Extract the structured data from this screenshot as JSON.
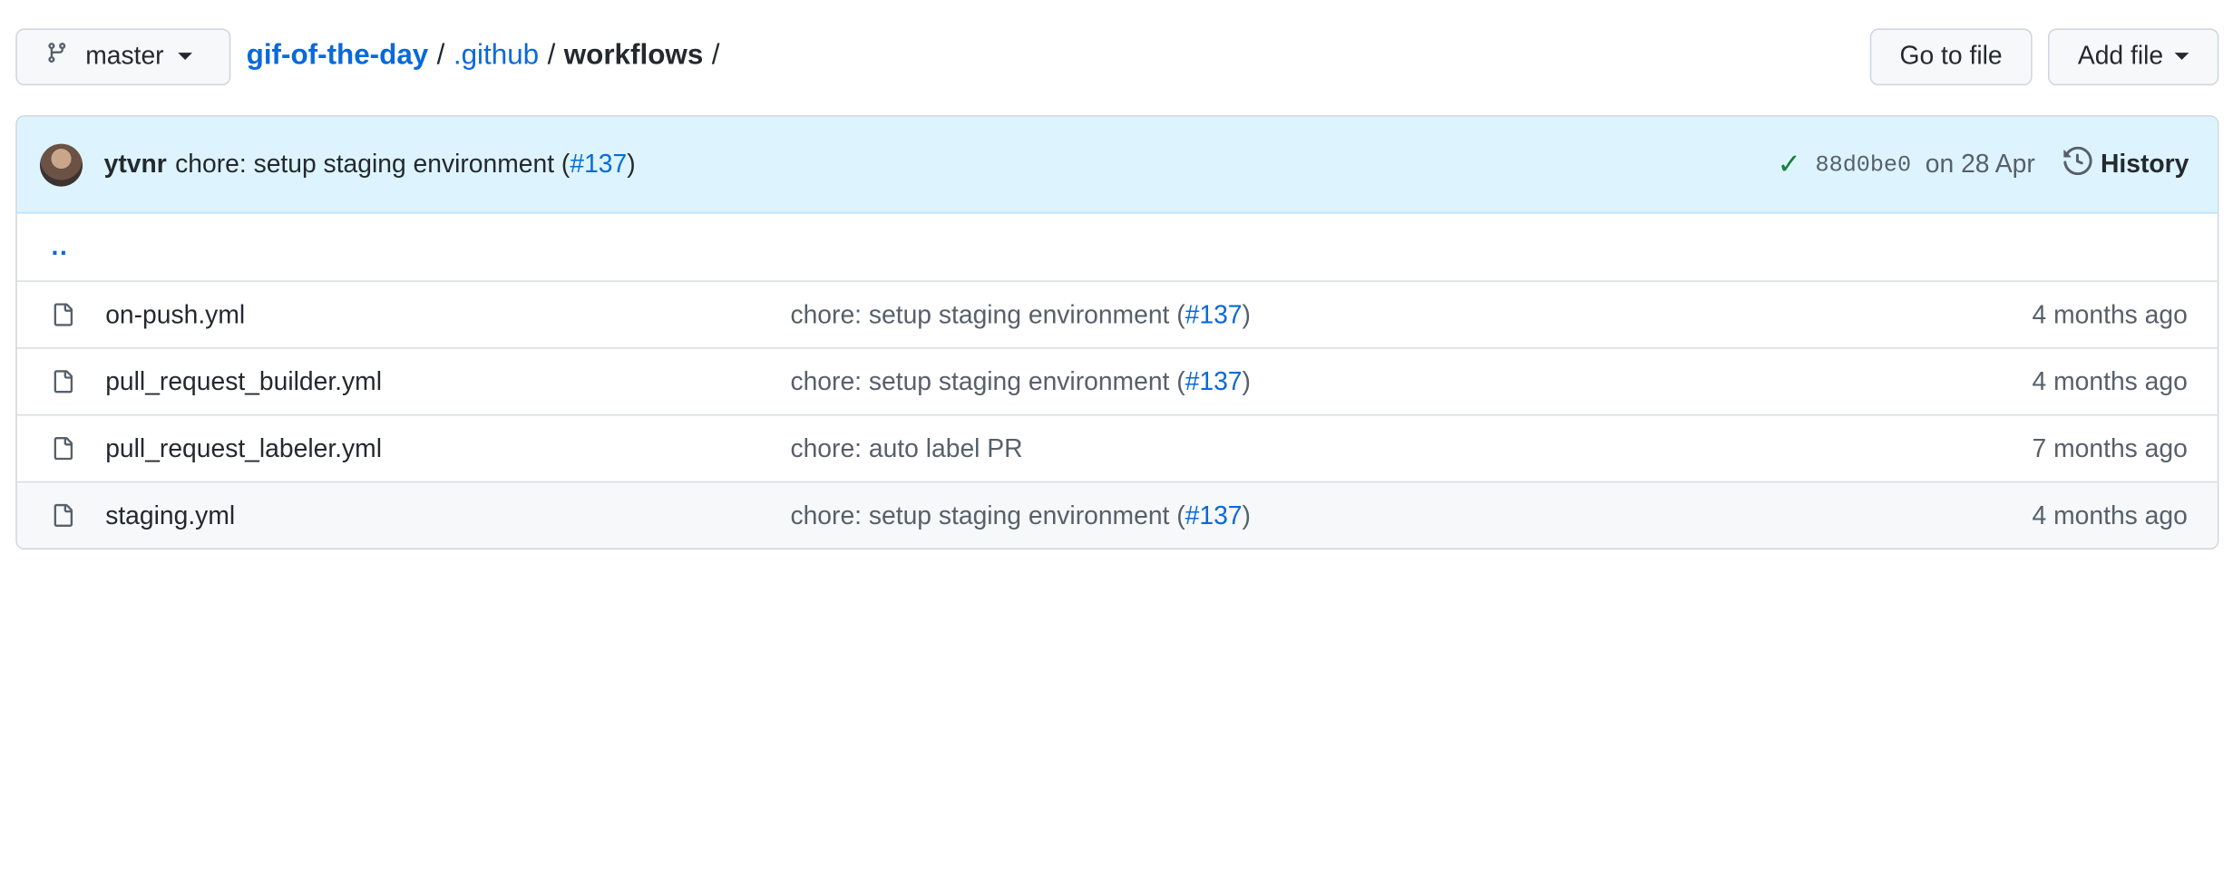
{
  "branch": {
    "label": "master"
  },
  "breadcrumb": {
    "repo": "gif-of-the-day",
    "folder": ".github",
    "current": "workflows",
    "sep": "/"
  },
  "actions": {
    "go_to_file": "Go to file",
    "add_file": "Add file"
  },
  "latest_commit": {
    "author": "ytvnr",
    "message": "chore: setup staging environment (",
    "pr": "#137",
    "message_end": ")",
    "sha": "88d0be0",
    "date": "on 28 Apr",
    "history_label": "History",
    "status_color": "#1a7f37"
  },
  "parent_dir": "..",
  "files": [
    {
      "name": "on-push.yml",
      "message": "chore: setup staging environment (",
      "pr": "#137",
      "message_end": ")",
      "age": "4 months ago"
    },
    {
      "name": "pull_request_builder.yml",
      "message": "chore: setup staging environment (",
      "pr": "#137",
      "message_end": ")",
      "age": "4 months ago"
    },
    {
      "name": "pull_request_labeler.yml",
      "message": "chore: auto label PR",
      "pr": "",
      "message_end": "",
      "age": "7 months ago"
    },
    {
      "name": "staging.yml",
      "message": "chore: setup staging environment (",
      "pr": "#137",
      "message_end": ")",
      "age": "4 months ago"
    }
  ],
  "colors": {
    "link": "#0969da",
    "commit_bar_bg": "#ddf4ff",
    "border": "#d0d7de"
  }
}
